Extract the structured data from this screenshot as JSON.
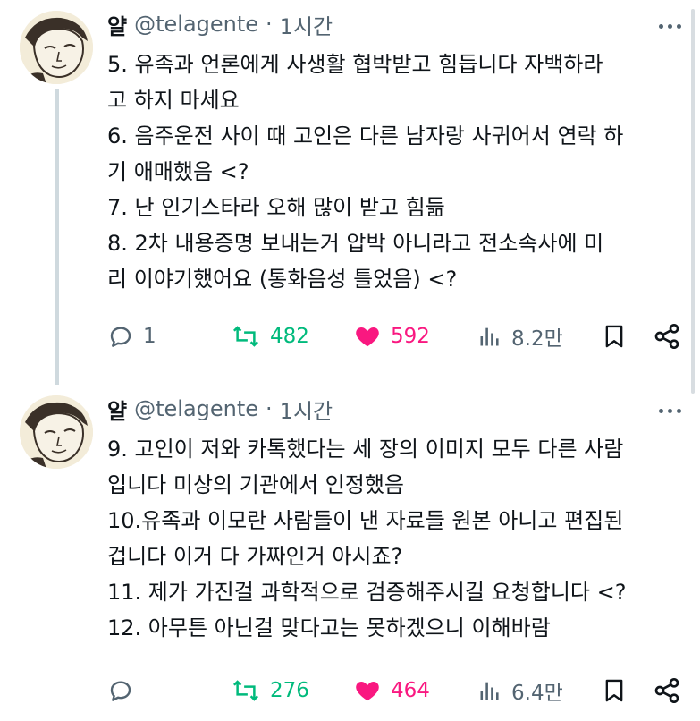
{
  "colors": {
    "retweet": "#00ba7c",
    "like": "#f91880",
    "muted": "#536471",
    "text": "#0f1419"
  },
  "tweets": [
    {
      "author_name": "얄",
      "handle": "@telagente",
      "separator": "·",
      "time": "1시간",
      "lines": [
        "5. 유족과 언론에게 사생활 협박받고 힘듭니다 자백하라",
        "고 하지 마세요",
        "6. 음주운전 사이 때 고인은 다른 남자랑 사귀어서 연락 하",
        "기 애매했음 <?",
        "7. 난 인기스타라 오해 많이 받고 힘듦",
        "8. 2차 내용증명 보내는거 압박 아니라고 전소속사에 미",
        "리 이야기했어요 (통화음성 틀었음) <?"
      ],
      "replies": "1",
      "retweets": "482",
      "likes": "592",
      "views": "8.2만"
    },
    {
      "author_name": "얄",
      "handle": "@telagente",
      "separator": "·",
      "time": "1시간",
      "lines": [
        "9. 고인이 저와 카톡했다는 세 장의 이미지 모두 다른 사람",
        "입니다 미상의 기관에서 인정했음",
        "10.유족과 이모란 사람들이 낸 자료들 원본 아니고 편집된",
        "겁니다 이거 다 가짜인거 아시죠?",
        "11. 제가 가진걸 과학적으로 검증해주시길 요청합니다 <?",
        "12. 아무튼 아닌걸 맞다고는 못하겠으니 이해바람"
      ],
      "replies": "",
      "retweets": "276",
      "likes": "464",
      "views": "6.4만"
    }
  ],
  "icons": {
    "avatar": "avatar-illustration",
    "more": "more-icon",
    "reply": "reply-icon",
    "retweet": "retweet-icon",
    "like": "heart-icon",
    "views": "views-icon",
    "bookmark": "bookmark-icon",
    "share": "share-icon"
  }
}
